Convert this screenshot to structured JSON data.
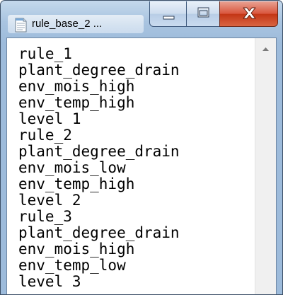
{
  "window": {
    "title": "rule_base_2 ...",
    "icons": {
      "app": "notepad-document-icon",
      "minimize": "minimize-icon",
      "maximize": "maximize-icon",
      "close": "close-icon",
      "scroll_up": "chevron-up-icon"
    },
    "colors": {
      "titlebar": "#a9c4e0",
      "close_button": "#c33515",
      "text": "#000000",
      "background": "#ffffff"
    }
  },
  "editor": {
    "lines": [
      "rule_1",
      "plant_degree_drain",
      "env_mois_high",
      "env_temp_high",
      "level 1",
      "rule_2",
      "plant_degree_drain",
      "env_mois_low",
      "env_temp_high",
      "level 2",
      "rule_3",
      "plant_degree_drain",
      "env_mois_high",
      "env_temp_low",
      "level 3"
    ]
  }
}
